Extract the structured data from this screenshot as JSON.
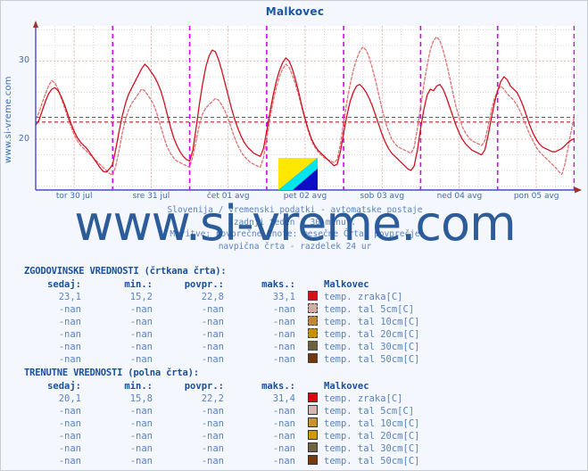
{
  "page": {
    "title": "Malkovec",
    "vertical_watermark": "www.si-vreme.com",
    "big_watermark": "www.si-vreme.com",
    "background": "#f4f7fd",
    "title_color": "#1a57a8"
  },
  "subtitle": {
    "line1": "Slovenija / vremenski podatki - avtomatske postaje",
    "line2": "zadnji teden / 30 minut.",
    "line3": "Meritve: povprečne  Enote: mesečne  Črta: povprečje",
    "line4": "navpična črta - razdelek 24 ur"
  },
  "chart_data": {
    "type": "line",
    "title": "Malkovec",
    "xlabel": "",
    "ylabel": "",
    "ylim": [
      13.5,
      34.5
    ],
    "yticks": [
      20,
      30
    ],
    "grid": true,
    "legend_position": "below-table",
    "x_tick_labels": [
      "tor 30 jul",
      "sre 31 jul",
      "čet 01 avg",
      "pet 02 avg",
      "sob 03 avg",
      "ned 04 avg",
      "pon 05 avg"
    ],
    "day_separator_note": "navpična črta - razdelek 24 ur",
    "average_lines": [
      {
        "name": "zgodovinsko povprečje",
        "value": 22.8,
        "style": "dashed",
        "color": "#c03040"
      },
      {
        "name": "trenutno povprečje",
        "value": 22.2,
        "style": "dashed",
        "color": "#b02030"
      }
    ],
    "series": [
      {
        "name": "temp. zraka[C] - zgodovinske vrednosti",
        "style": "dashed",
        "color": "#dd7070",
        "values": [
          22.6,
          23.4,
          24.6,
          25.8,
          26.8,
          27.5,
          27.2,
          26.4,
          25.2,
          24.0,
          22.8,
          21.6,
          20.6,
          19.8,
          19.2,
          18.8,
          18.4,
          18.0,
          17.6,
          17.2,
          16.8,
          16.4,
          16.0,
          15.6,
          15.4,
          16.6,
          18.6,
          20.8,
          22.6,
          23.8,
          24.6,
          25.2,
          25.8,
          26.4,
          26.2,
          25.6,
          25.0,
          24.2,
          23.0,
          21.6,
          20.2,
          19.0,
          18.2,
          17.6,
          17.2,
          17.0,
          16.8,
          16.6,
          16.4,
          17.8,
          19.8,
          21.8,
          23.2,
          24.0,
          24.4,
          24.8,
          25.2,
          25.0,
          24.4,
          23.6,
          22.6,
          21.4,
          20.2,
          19.2,
          18.4,
          17.8,
          17.4,
          17.0,
          16.8,
          16.6,
          16.4,
          17.6,
          20.0,
          22.6,
          24.8,
          26.6,
          28.0,
          29.0,
          29.6,
          29.2,
          28.2,
          27.0,
          25.6,
          24.0,
          22.4,
          21.0,
          19.8,
          19.0,
          18.4,
          18.0,
          17.6,
          17.4,
          17.2,
          17.0,
          17.4,
          19.4,
          22.2,
          24.8,
          27.0,
          28.8,
          30.2,
          31.2,
          31.8,
          31.4,
          30.4,
          29.0,
          27.4,
          25.6,
          23.8,
          22.2,
          21.0,
          20.0,
          19.4,
          19.0,
          18.8,
          18.6,
          18.4,
          18.2,
          19.0,
          21.4,
          24.2,
          27.0,
          29.4,
          31.4,
          32.6,
          33.1,
          32.6,
          31.4,
          29.8,
          28.0,
          26.0,
          24.2,
          22.8,
          21.6,
          20.8,
          20.2,
          19.8,
          19.6,
          19.4,
          19.2,
          19.8,
          21.6,
          23.6,
          25.2,
          26.2,
          26.8,
          26.4,
          25.8,
          25.4,
          25.0,
          24.4,
          23.6,
          22.6,
          21.6,
          20.6,
          19.8,
          19.0,
          18.4,
          18.0,
          17.6,
          17.2,
          16.8,
          16.4,
          15.9,
          15.5,
          16.8,
          19.0,
          21.2,
          23.1
        ]
      },
      {
        "name": "temp. zraka[C] - trenutne vrednosti",
        "style": "solid",
        "color": "#d01020",
        "values": [
          21.8,
          22.4,
          23.6,
          24.8,
          25.8,
          26.4,
          26.6,
          26.2,
          25.4,
          24.4,
          23.2,
          22.0,
          21.0,
          20.2,
          19.6,
          19.2,
          18.8,
          18.2,
          17.6,
          17.0,
          16.4,
          15.9,
          15.8,
          16.2,
          16.8,
          18.8,
          21.0,
          23.0,
          24.6,
          25.8,
          26.6,
          27.4,
          28.2,
          29.0,
          29.6,
          29.2,
          28.6,
          28.0,
          27.2,
          26.2,
          24.8,
          23.2,
          21.6,
          20.2,
          19.2,
          18.4,
          17.8,
          17.4,
          17.2,
          18.6,
          21.4,
          24.4,
          27.0,
          29.2,
          30.6,
          31.4,
          31.2,
          30.2,
          28.8,
          27.2,
          25.6,
          24.0,
          22.6,
          21.4,
          20.4,
          19.6,
          19.0,
          18.6,
          18.2,
          18.0,
          17.8,
          18.8,
          21.0,
          23.4,
          25.6,
          27.4,
          28.8,
          29.8,
          30.4,
          30.0,
          29.0,
          27.6,
          26.0,
          24.2,
          22.6,
          21.2,
          20.0,
          19.2,
          18.6,
          18.2,
          17.8,
          17.4,
          17.0,
          16.6,
          16.8,
          18.4,
          20.8,
          23.0,
          24.8,
          26.0,
          26.8,
          27.0,
          26.6,
          26.0,
          25.2,
          24.2,
          23.0,
          21.8,
          20.6,
          19.6,
          18.8,
          18.2,
          17.8,
          17.4,
          17.0,
          16.6,
          16.2,
          16.0,
          16.6,
          18.6,
          21.4,
          23.8,
          25.6,
          26.4,
          26.2,
          26.8,
          27.0,
          26.4,
          25.4,
          24.2,
          23.0,
          21.8,
          20.8,
          20.0,
          19.4,
          19.0,
          18.6,
          18.4,
          18.2,
          18.0,
          18.6,
          20.4,
          22.6,
          24.6,
          26.2,
          27.4,
          28.0,
          27.6,
          26.8,
          26.4,
          26.0,
          25.2,
          24.2,
          23.0,
          21.8,
          20.8,
          20.0,
          19.4,
          19.0,
          18.8,
          18.6,
          18.4,
          18.4,
          18.6,
          18.8,
          19.2,
          19.6,
          19.9,
          20.1
        ]
      }
    ]
  },
  "historical": {
    "heading": "ZGODOVINSKE VREDNOSTI (črtkana črta):",
    "columns": [
      "sedaj:",
      "min.:",
      "povpr.:",
      "maks.:",
      "Malkovec"
    ],
    "rows": [
      {
        "sedaj": "23,1",
        "min": "15,2",
        "povpr": "22,8",
        "maks": "33,1",
        "label": "temp. zraka[C]",
        "color": "#d81016"
      },
      {
        "sedaj": "-nan",
        "min": "-nan",
        "povpr": "-nan",
        "maks": "-nan",
        "label": "temp. tal  5cm[C]",
        "color": "#ceada4"
      },
      {
        "sedaj": "-nan",
        "min": "-nan",
        "povpr": "-nan",
        "maks": "-nan",
        "label": "temp. tal 10cm[C]",
        "color": "#c08a33"
      },
      {
        "sedaj": "-nan",
        "min": "-nan",
        "povpr": "-nan",
        "maks": "-nan",
        "label": "temp. tal 20cm[C]",
        "color": "#c79106"
      },
      {
        "sedaj": "-nan",
        "min": "-nan",
        "povpr": "-nan",
        "maks": "-nan",
        "label": "temp. tal 30cm[C]",
        "color": "#6b6040"
      },
      {
        "sedaj": "-nan",
        "min": "-nan",
        "povpr": "-nan",
        "maks": "-nan",
        "label": "temp. tal 50cm[C]",
        "color": "#73380c"
      }
    ]
  },
  "current": {
    "heading": "TRENUTNE VREDNOSTI (polna črta):",
    "columns": [
      "sedaj:",
      "min.:",
      "povpr.:",
      "maks.:",
      "Malkovec"
    ],
    "rows": [
      {
        "sedaj": "20,1",
        "min": "15,8",
        "povpr": "22,2",
        "maks": "31,4",
        "label": "temp. zraka[C]",
        "color": "#e4000c"
      },
      {
        "sedaj": "-nan",
        "min": "-nan",
        "povpr": "-nan",
        "maks": "-nan",
        "label": "temp. tal  5cm[C]",
        "color": "#d5b6b0"
      },
      {
        "sedaj": "-nan",
        "min": "-nan",
        "povpr": "-nan",
        "maks": "-nan",
        "label": "temp. tal 10cm[C]",
        "color": "#c99330"
      },
      {
        "sedaj": "-nan",
        "min": "-nan",
        "povpr": "-nan",
        "maks": "-nan",
        "label": "temp. tal 20cm[C]",
        "color": "#cf9a00"
      },
      {
        "sedaj": "-nan",
        "min": "-nan",
        "povpr": "-nan",
        "maks": "-nan",
        "label": "temp. tal 30cm[C]",
        "color": "#6f6542"
      },
      {
        "sedaj": "-nan",
        "min": "-nan",
        "povpr": "-nan",
        "maks": "-nan",
        "label": "temp. tal 50cm[C]",
        "color": "#7a3a08"
      }
    ]
  }
}
